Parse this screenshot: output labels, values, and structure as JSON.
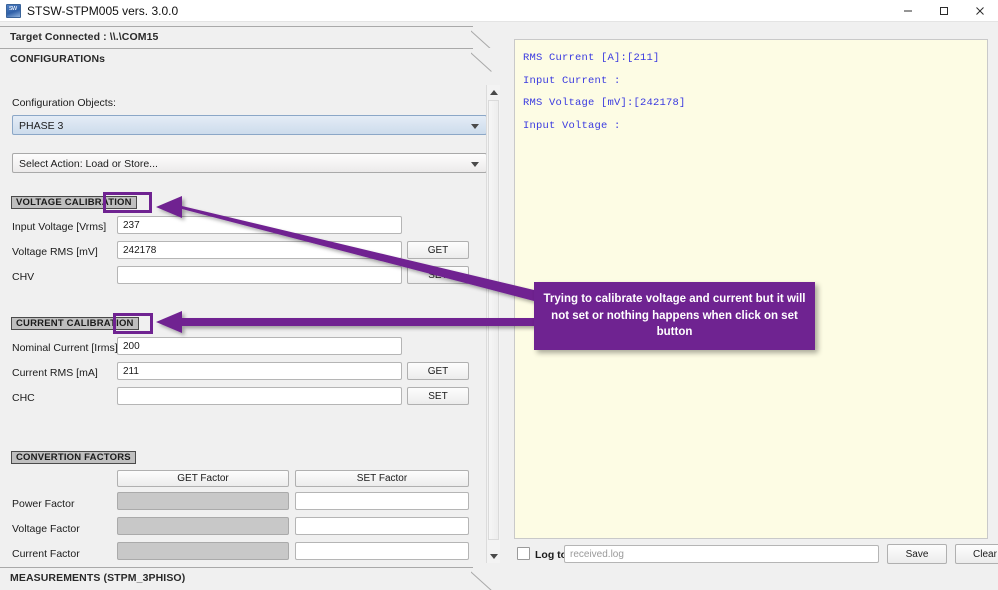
{
  "window": {
    "title": "STSW-STPM005 vers. 3.0.0",
    "icon": "app-icon",
    "minimize_label": "minimize-icon",
    "maximize_label": "maximize-icon",
    "close_label": "close-icon"
  },
  "groups": {
    "target": "Target Connected : \\\\.\\COM15",
    "configurations": "CONFIGURATIONs",
    "measurements": "MEASUREMENTS (STPM_3PHISO)"
  },
  "config": {
    "objects_label": "Configuration Objects:",
    "object_value": "PHASE 3",
    "action_value": "Select Action: Load or Store..."
  },
  "voltage_section": {
    "title": "VOLTAGE CALIBRATION",
    "rows": [
      {
        "label": "Input Voltage [Vrms]",
        "value": "237",
        "button": ""
      },
      {
        "label": "Voltage RMS [mV]",
        "value": "242178",
        "button": "GET"
      },
      {
        "label": "CHV",
        "value": "",
        "button": "SET"
      }
    ]
  },
  "current_section": {
    "title": "CURRENT CALIBRATION",
    "rows": [
      {
        "label": "Nominal Current [Irms]",
        "value": "200",
        "button": ""
      },
      {
        "label": "Current RMS [mA]",
        "value": "211",
        "button": "GET"
      },
      {
        "label": "CHC",
        "value": "",
        "button": "SET"
      }
    ]
  },
  "factors_section": {
    "title": "CONVERTION FACTORS",
    "col_get": "GET Factor",
    "col_set": "SET Factor",
    "rows": [
      {
        "label": "Power Factor",
        "get": "",
        "set": ""
      },
      {
        "label": "Voltage Factor",
        "get": "",
        "set": ""
      },
      {
        "label": "Current Factor",
        "get": "",
        "set": ""
      }
    ]
  },
  "log": {
    "lines": [
      "RMS Current [A]:[211]",
      "Input Current :",
      "RMS Voltage [mV]:[242178]",
      "Input Voltage :"
    ],
    "log_to_label": "Log to",
    "file_placeholder": "received.log",
    "save_label": "Save",
    "clear_label": "Clear"
  },
  "annotation": {
    "note": "Trying to calibrate voltage and current but it will not set or nothing happens when click on set button",
    "accent_color": "#6f2391"
  }
}
